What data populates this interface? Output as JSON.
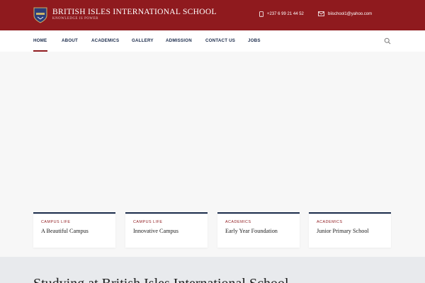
{
  "header": {
    "school_name": "BRITISH ISLES INTERNATIONAL SCHOOL",
    "motto": "KNOWLEDGE IS POWER",
    "phone": "+237 6 99 21 44 52",
    "email": "biischool1@yahoo.com",
    "brand_color": "#8f1a1e",
    "logo_icon": "school-crest-icon"
  },
  "nav": {
    "items": [
      {
        "label": "HOME",
        "active": true
      },
      {
        "label": "ABOUT",
        "active": false
      },
      {
        "label": "ACADEMICS",
        "active": false
      },
      {
        "label": "GALLERY",
        "active": false
      },
      {
        "label": "ADMISSION",
        "active": false
      },
      {
        "label": "CONTACT US",
        "active": false
      },
      {
        "label": "JOBS",
        "active": false
      }
    ],
    "search_icon": "search-icon"
  },
  "cards": [
    {
      "category": "CAMPUS LIFE",
      "title": "A Beautiful Campus"
    },
    {
      "category": "CAMPUS LIFE",
      "title": "Innovative Campus"
    },
    {
      "category": "ACADEMICS",
      "title": "Early Year Foundation"
    },
    {
      "category": "ACADEMICS",
      "title": "Junior Primary School"
    }
  ],
  "band": {
    "title": "Studying at British Isles International School"
  }
}
